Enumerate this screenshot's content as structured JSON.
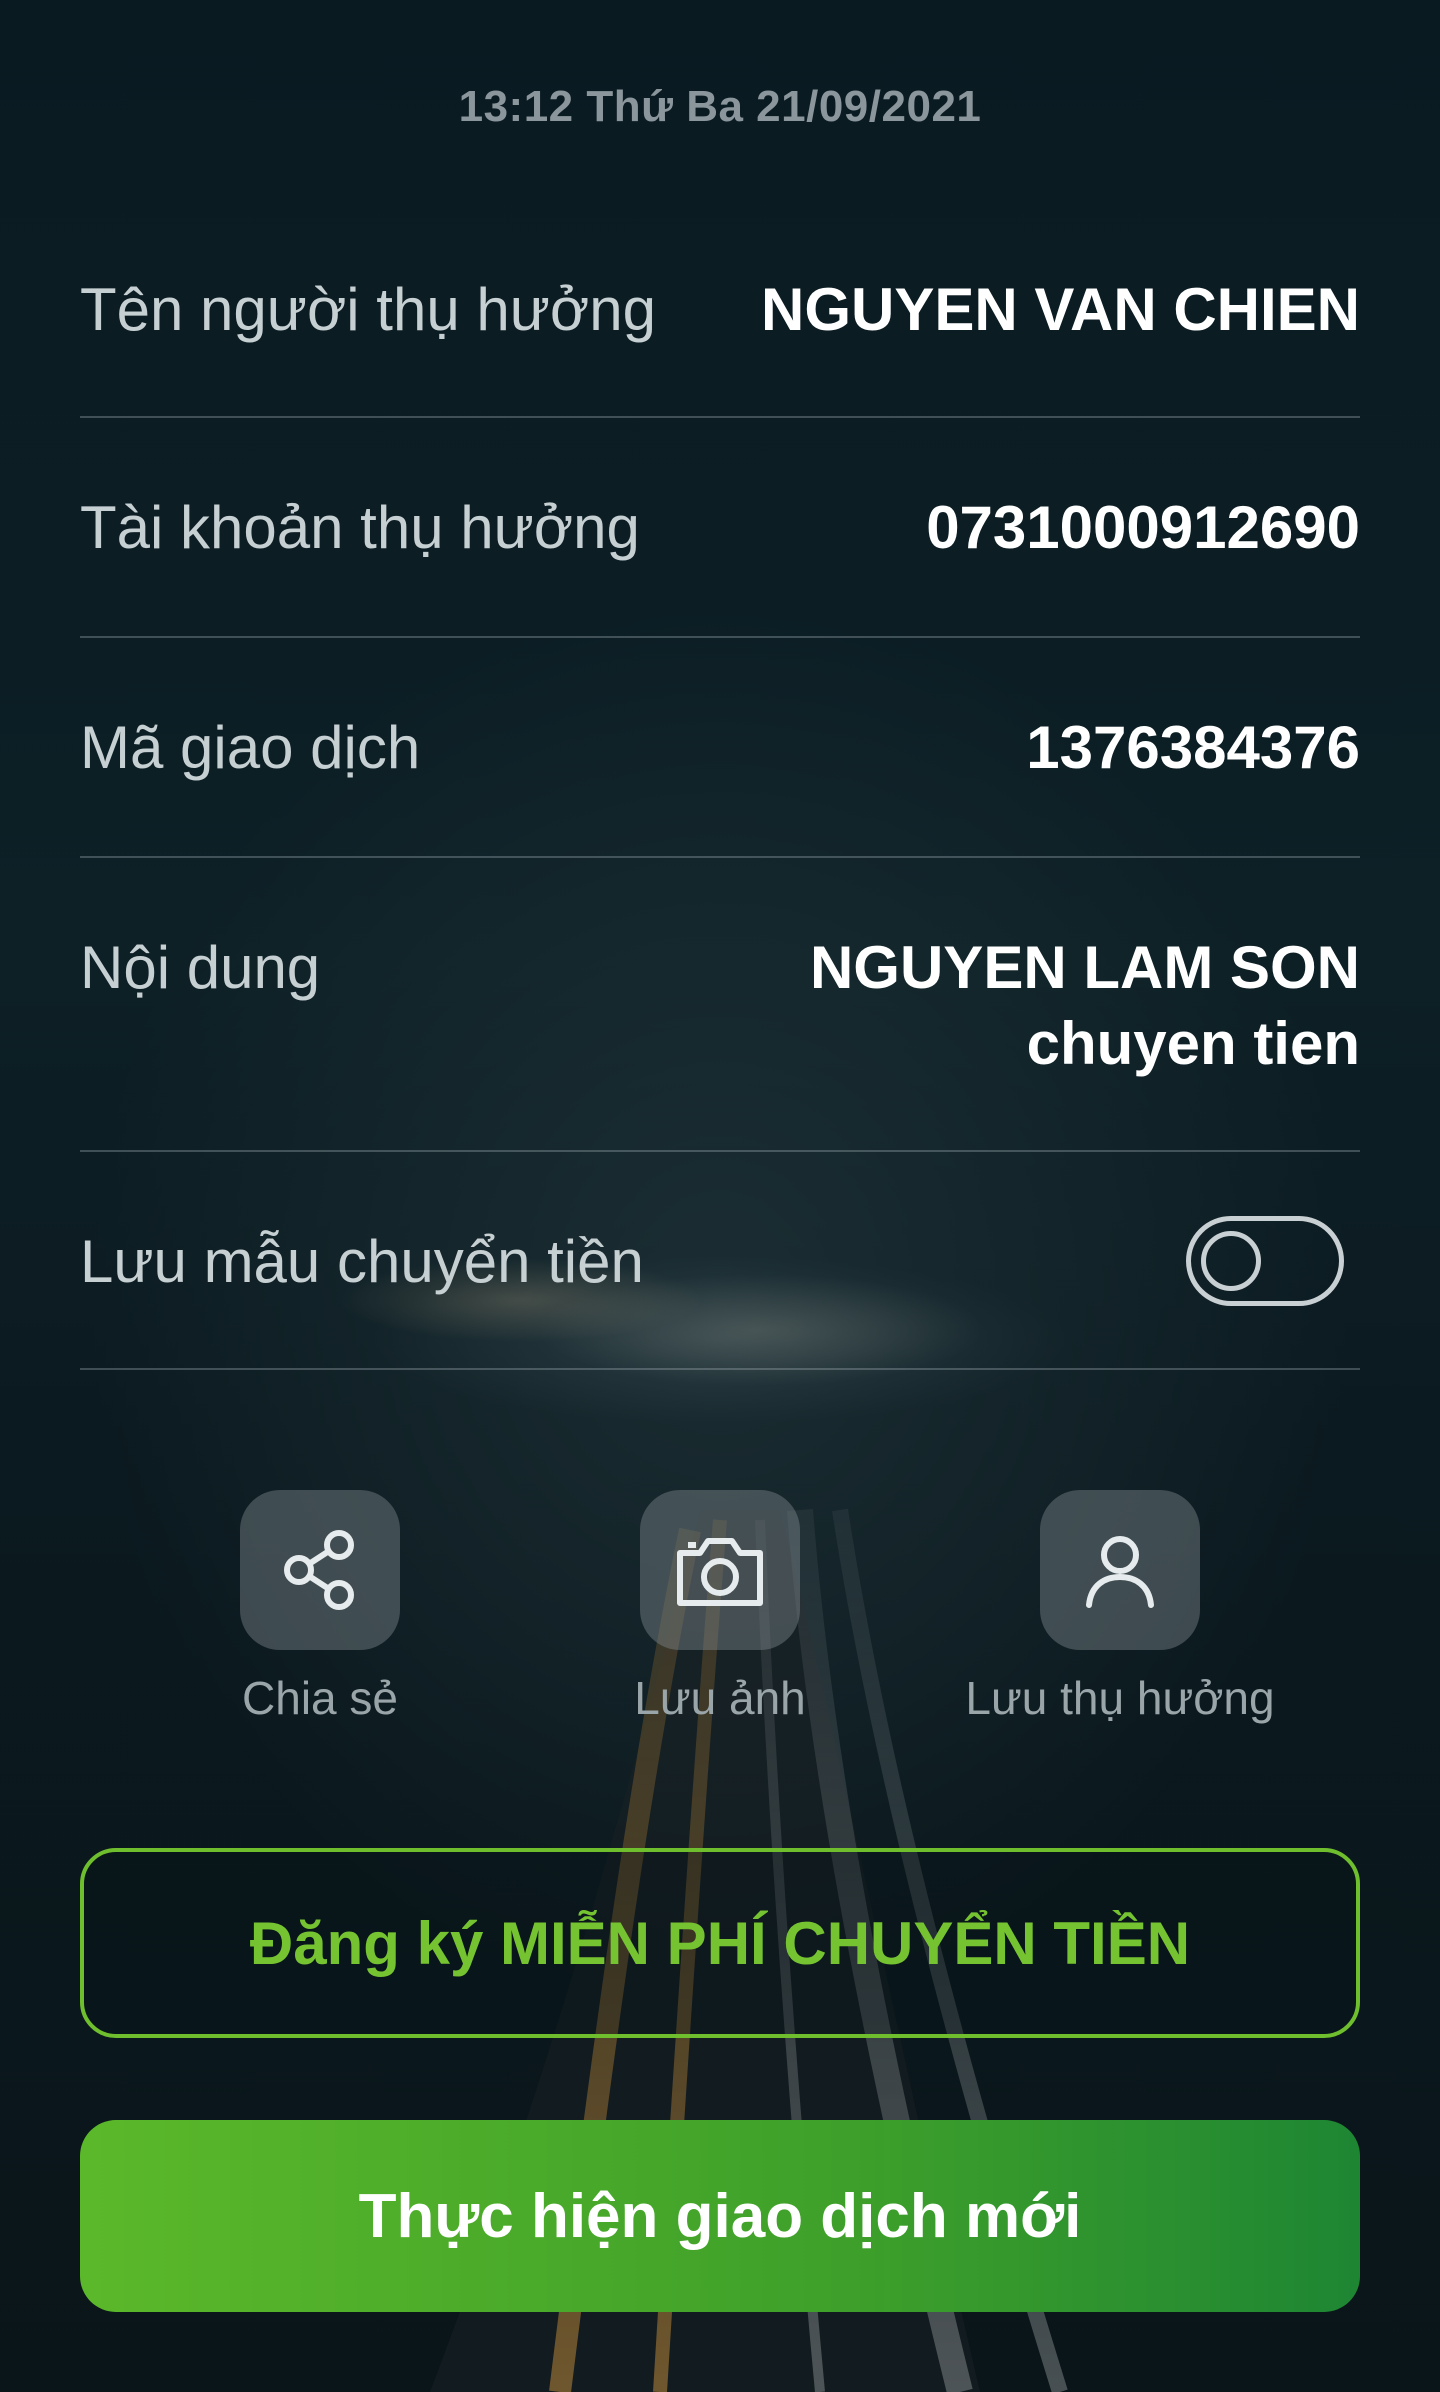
{
  "status": {
    "timestamp": "13:12 Thứ Ba 21/09/2021"
  },
  "details": {
    "beneficiary_name_label": "Tên người thụ hưởng",
    "beneficiary_name_value": "NGUYEN VAN CHIEN",
    "beneficiary_account_label": "Tài khoản thụ hưởng",
    "beneficiary_account_value": "0731000912690",
    "transaction_code_label": "Mã giao dịch",
    "transaction_code_value": "1376384376",
    "content_label": "Nội dung",
    "content_value_line1": "NGUYEN LAM SON",
    "content_value_line2": "chuyen tien",
    "save_template_label": "Lưu mẫu chuyển tiền",
    "save_template_enabled": false
  },
  "actions": [
    {
      "label": "Chia sẻ",
      "icon": "share-icon"
    },
    {
      "label": "Lưu ảnh",
      "icon": "camera-icon"
    },
    {
      "label": "Lưu thụ hưởng",
      "icon": "user-icon"
    }
  ],
  "buttons": {
    "register_free_label": "Đăng ký MIỄN PHÍ CHUYỂN TIỀN",
    "new_transaction_label": "Thực hiện giao dịch mới"
  },
  "colors": {
    "accent_green": "#6fbe2e",
    "button_gradient_start": "#5bb82a",
    "button_gradient_end": "#1e8633",
    "background": "#0b1a20"
  }
}
